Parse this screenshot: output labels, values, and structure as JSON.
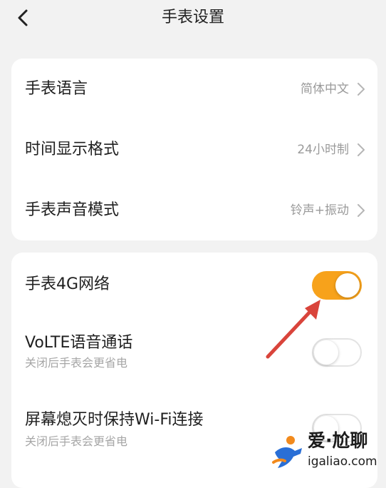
{
  "header": {
    "title": "手表设置",
    "back_icon": "chevron-left-icon"
  },
  "general": {
    "items": [
      {
        "label": "手表语言",
        "value": "简体中文"
      },
      {
        "label": "时间显示格式",
        "value": "24小时制"
      },
      {
        "label": "手表声音模式",
        "value": "铃声+振动"
      }
    ]
  },
  "network": {
    "items": [
      {
        "label": "手表4G网络",
        "enabled": true
      },
      {
        "label": "VoLTE语音通话",
        "subtitle": "关闭后手表会更省电",
        "enabled": false
      },
      {
        "label": "屏幕熄灭时保持Wi-Fi连接",
        "subtitle": "关闭后手表会更省电",
        "enabled": false
      }
    ]
  },
  "watermark": {
    "name": "爱·尬聊",
    "url": "igaliao.com"
  },
  "colors": {
    "accent": "#f7a21b",
    "arrow": "#d9443b",
    "background": "#f2f2f2"
  }
}
